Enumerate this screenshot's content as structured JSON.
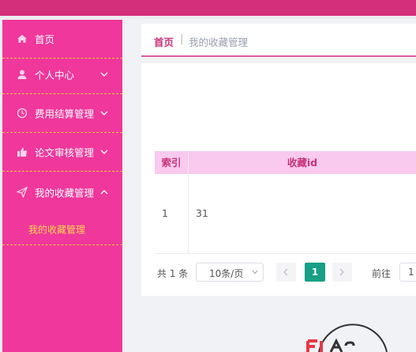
{
  "sidebar": {
    "items": [
      {
        "label": "首页",
        "icon": "home-icon",
        "expandable": false
      },
      {
        "label": "个人中心",
        "icon": "user-icon",
        "expandable": true
      },
      {
        "label": "费用结算管理",
        "icon": "clock-icon",
        "expandable": true
      },
      {
        "label": "论文审核管理",
        "icon": "thumbs-up-icon",
        "expandable": true
      },
      {
        "label": "我的收藏管理",
        "icon": "send-icon",
        "expandable": true,
        "expanded": true
      }
    ],
    "submenu": {
      "label": "我的收藏管理"
    }
  },
  "breadcrumb": {
    "home": "首页",
    "separator": "|",
    "current": "我的收藏管理"
  },
  "table": {
    "headers": [
      "索引",
      "收藏id"
    ],
    "rows": [
      [
        "1",
        "31"
      ]
    ]
  },
  "pagination": {
    "total": "共 1 条",
    "page_size": "10条/页",
    "current_page": "1",
    "goto_label": "前往",
    "goto_value": "1"
  },
  "colors": {
    "sidebar": "#f0379c",
    "topbar": "#d32f7a",
    "accent": "#c7357c",
    "active_page": "#16a085",
    "submenu_text": "#ffd84a",
    "table_header": "#f9c9ee"
  }
}
